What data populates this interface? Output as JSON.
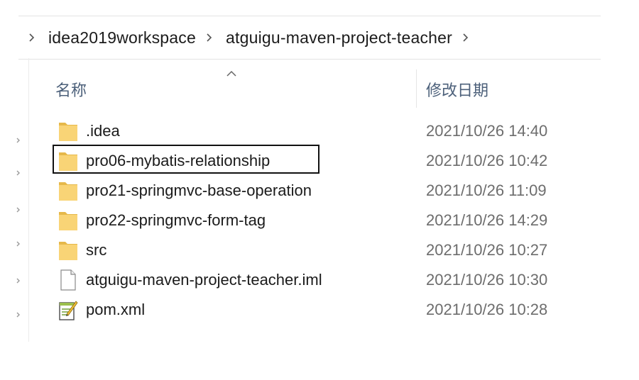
{
  "breadcrumb": {
    "items": [
      {
        "label": "idea2019workspace"
      },
      {
        "label": "atguigu-maven-project-teacher"
      }
    ]
  },
  "columns": {
    "name": "名称",
    "date_modified": "修改日期"
  },
  "files": [
    {
      "name": ".idea",
      "date": "2021/10/26 14:40",
      "icon": "folder-icon"
    },
    {
      "name": "pro06-mybatis-relationship",
      "date": "2021/10/26 10:42",
      "icon": "folder-icon",
      "highlighted": true
    },
    {
      "name": "pro21-springmvc-base-operation",
      "date": "2021/10/26 11:09",
      "icon": "folder-icon"
    },
    {
      "name": "pro22-springmvc-form-tag",
      "date": "2021/10/26 14:29",
      "icon": "folder-icon"
    },
    {
      "name": "src",
      "date": "2021/10/26 10:27",
      "icon": "folder-icon"
    },
    {
      "name": "atguigu-maven-project-teacher.iml",
      "date": "2021/10/26 10:30",
      "icon": "file-icon"
    },
    {
      "name": "pom.xml",
      "date": "2021/10/26 10:28",
      "icon": "xml-file-icon"
    }
  ],
  "colors": {
    "folder": "#f9d476",
    "folder_dark": "#e6b84a",
    "header_text": "#4c607a",
    "date_text": "#6d6d6d",
    "highlight_border": "#111111"
  }
}
